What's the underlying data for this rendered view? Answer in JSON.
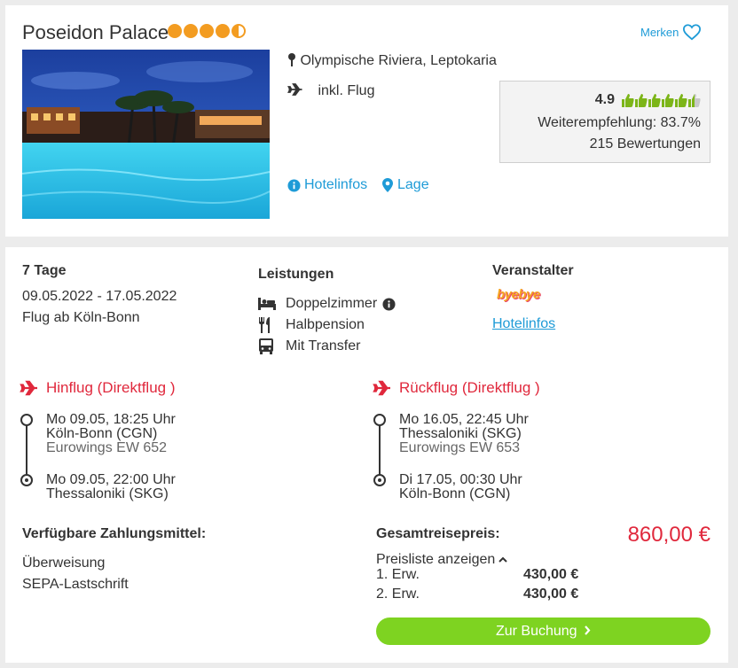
{
  "hotel": {
    "name": "Poseidon Palace",
    "stars": 4.5,
    "location": "Olympische Riviera, Leptokaria",
    "flight_included": "inkl. Flug",
    "merken_label": "Merken",
    "hotelinfos_link": "Hotelinfos",
    "lage_link": "Lage",
    "image_alt": "Hotel pool at night"
  },
  "rating": {
    "score": "4.9",
    "thumbs_filled": 5.5,
    "thumbs_total": 6,
    "recommendation": "Weiterempfehlung: 83.7%",
    "reviews": "215 Bewertungen"
  },
  "trip": {
    "duration": "7 Tage",
    "dates": "09.05.2022 - 17.05.2022",
    "departure": "Flug ab Köln-Bonn"
  },
  "services": {
    "heading": "Leistungen",
    "items": [
      "Doppelzimmer",
      "Halbpension",
      "Mit Transfer"
    ]
  },
  "operator": {
    "heading": "Veranstalter",
    "logo_text": "byebye",
    "link": "Hotelinfos"
  },
  "outbound": {
    "title": "Hinflug (Direktflug )",
    "dep_time": "Mo 09.05, 18:25 Uhr",
    "dep_airport": "Köln-Bonn (CGN)",
    "carrier": "Eurowings EW 652",
    "arr_time": "Mo 09.05, 22:00 Uhr",
    "arr_airport": "Thessaloniki (SKG)"
  },
  "return": {
    "title": "Rückflug (Direktflug )",
    "dep_time": "Mo 16.05, 22:45 Uhr",
    "dep_airport": "Thessaloniki (SKG)",
    "carrier": "Eurowings EW 653",
    "arr_time": "Di 17.05, 00:30 Uhr",
    "arr_airport": "Köln-Bonn (CGN)"
  },
  "payment": {
    "heading": "Verfügbare Zahlungsmittel:",
    "methods": [
      "Überweisung",
      "SEPA-Lastschrift"
    ]
  },
  "price": {
    "heading": "Gesamtreisepreis:",
    "total": "860,00 €",
    "toggle": "Preisliste anzeigen",
    "rows": [
      {
        "label": "1. Erw.",
        "value": "430,00 €"
      },
      {
        "label": "2. Erw.",
        "value": "430,00 €"
      }
    ],
    "book_label": "Zur Buchung"
  },
  "colors": {
    "accent_blue": "#1e9bd7",
    "price_red": "#e0283c",
    "book_green": "#7ed321",
    "star_orange": "#f39c21",
    "thumb_green": "#7cb518"
  }
}
